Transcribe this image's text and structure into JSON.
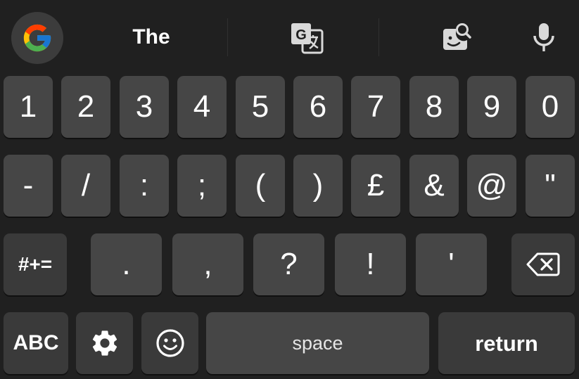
{
  "suggestion_bar": {
    "google_icon": "google-g-icon",
    "suggestion": "The",
    "translate_icon": "translate-icon",
    "sticker_icon": "sticker-search-icon",
    "mic_icon": "microphone-icon"
  },
  "rows": {
    "numbers": [
      "1",
      "2",
      "3",
      "4",
      "5",
      "6",
      "7",
      "8",
      "9",
      "0"
    ],
    "symbols": [
      "-",
      "/",
      ":",
      ";",
      "(",
      ")",
      "£",
      "&",
      "@",
      "\""
    ],
    "third": {
      "mode_label": "#+=",
      "keys": [
        ".",
        ",",
        "?",
        "!",
        "'"
      ],
      "backspace_icon": "backspace-icon"
    },
    "bottom": {
      "abc_label": "ABC",
      "settings_icon": "gear-icon",
      "emoji_icon": "smiley-icon",
      "space_label": "space",
      "return_label": "return"
    }
  },
  "colors": {
    "background": "#202020",
    "key": "#464646",
    "function_key": "#3a3a3a",
    "text": "#ffffff"
  }
}
